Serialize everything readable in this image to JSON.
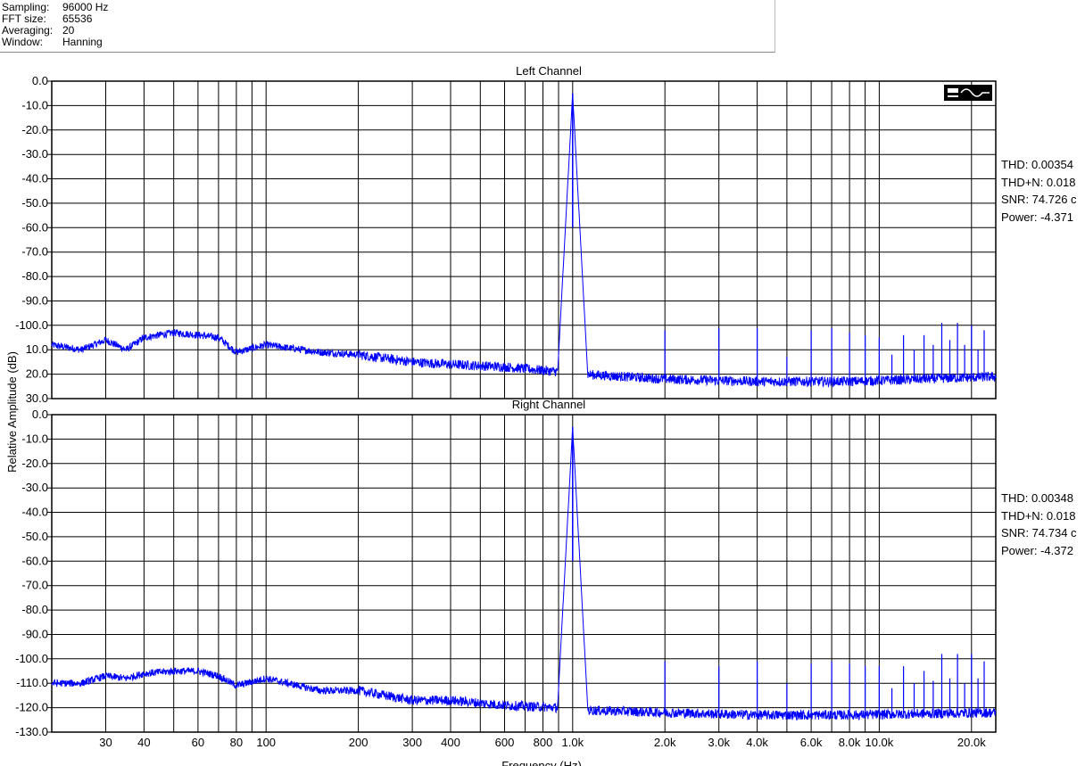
{
  "info": [
    {
      "key": "Sampling:",
      "value": "96000 Hz"
    },
    {
      "key": "FFT size:",
      "value": "65536"
    },
    {
      "key": "Averaging:",
      "value": "20"
    },
    {
      "key": "Window:",
      "value": "Hanning"
    }
  ],
  "stats": {
    "left": {
      "thd": "THD: 0.00354",
      "thdn": "THD+N: 0.018",
      "snr": "SNR: 74.726 c",
      "power": "Power: -4.371"
    },
    "right": {
      "thd": "THD: 0.00348",
      "thdn": "THD+N: 0.018",
      "snr": "SNR: 74.734 c",
      "power": "Power: -4.372"
    }
  },
  "chart_data": {
    "type": "line",
    "xlabel": "Frequency (Hz)",
    "ylabel": "Relative Amplitude (dB)",
    "xscale": "log",
    "xlim": [
      20,
      24000
    ],
    "ylim": [
      -130,
      0
    ],
    "grid": true,
    "line_color": "#0000ff",
    "x_ticks": [
      {
        "v": 30,
        "label": "30"
      },
      {
        "v": 40,
        "label": "40"
      },
      {
        "v": 60,
        "label": "60"
      },
      {
        "v": 80,
        "label": "80"
      },
      {
        "v": 100,
        "label": "100"
      },
      {
        "v": 200,
        "label": "200"
      },
      {
        "v": 300,
        "label": "300"
      },
      {
        "v": 400,
        "label": "400"
      },
      {
        "v": 600,
        "label": "600"
      },
      {
        "v": 800,
        "label": "800"
      },
      {
        "v": 1000,
        "label": "1.0k"
      },
      {
        "v": 2000,
        "label": "2.0k"
      },
      {
        "v": 3000,
        "label": "3.0k"
      },
      {
        "v": 4000,
        "label": "4.0k"
      },
      {
        "v": 6000,
        "label": "6.0k"
      },
      {
        "v": 8000,
        "label": "8.0k"
      },
      {
        "v": 10000,
        "label": "10.0k"
      },
      {
        "v": 20000,
        "label": "20.0k"
      }
    ],
    "grid_x": [
      30,
      40,
      50,
      60,
      70,
      80,
      90,
      100,
      200,
      300,
      400,
      500,
      600,
      700,
      800,
      900,
      1000,
      2000,
      3000,
      4000,
      5000,
      6000,
      7000,
      8000,
      9000,
      10000,
      20000
    ],
    "y_ticks": [
      {
        "v": 0,
        "label": "0.0"
      },
      {
        "v": -10,
        "label": "-10.0"
      },
      {
        "v": -20,
        "label": "-20.0"
      },
      {
        "v": -30,
        "label": "-30.0"
      },
      {
        "v": -40,
        "label": "-40.0"
      },
      {
        "v": -50,
        "label": "-50.0"
      },
      {
        "v": -60,
        "label": "-60.0"
      },
      {
        "v": -70,
        "label": "-70.0"
      },
      {
        "v": -80,
        "label": "-80.0"
      },
      {
        "v": -90,
        "label": "-90.0"
      },
      {
        "v": -100,
        "label": "-100.0"
      },
      {
        "v": -110,
        "label": "-110.0"
      },
      {
        "v": -120,
        "label": "-120.0"
      },
      {
        "v": -130,
        "label": "-130.0"
      }
    ],
    "y_ticks_top_clipped": [
      {
        "v": 0,
        "label": "0.0"
      },
      {
        "v": -10,
        "label": "-10.0"
      },
      {
        "v": -20,
        "label": "-20.0"
      },
      {
        "v": -30,
        "label": "-30.0"
      },
      {
        "v": -40,
        "label": "-40.0"
      },
      {
        "v": -50,
        "label": "-50.0"
      },
      {
        "v": -60,
        "label": "-60.0"
      },
      {
        "v": -70,
        "label": "-70.0"
      },
      {
        "v": -80,
        "label": "-80.0"
      },
      {
        "v": -90,
        "label": "-90.0"
      },
      {
        "v": -100,
        "label": "-100.0"
      },
      {
        "v": -110,
        "label": "10.0"
      },
      {
        "v": -120,
        "label": "20.0"
      },
      {
        "v": -130,
        "label": "30.0"
      }
    ],
    "panels": [
      {
        "title": "Left Channel",
        "fundamental": {
          "f": 1000,
          "db": -5
        },
        "floor": [
          [
            20,
            -108
          ],
          [
            25,
            -110
          ],
          [
            30,
            -106
          ],
          [
            35,
            -110
          ],
          [
            40,
            -105
          ],
          [
            50,
            -103
          ],
          [
            60,
            -104
          ],
          [
            70,
            -105
          ],
          [
            80,
            -111
          ],
          [
            100,
            -108
          ],
          [
            150,
            -111
          ],
          [
            200,
            -112
          ],
          [
            300,
            -115
          ],
          [
            400,
            -116
          ],
          [
            600,
            -117
          ],
          [
            900,
            -119
          ]
        ],
        "floor_after": [
          [
            1080,
            -120
          ],
          [
            2000,
            -122
          ],
          [
            4000,
            -123
          ],
          [
            8000,
            -123
          ],
          [
            24000,
            -121
          ]
        ],
        "harmonics": [
          [
            2000,
            -102
          ],
          [
            3000,
            -101
          ],
          [
            4000,
            -101
          ],
          [
            5000,
            -113
          ],
          [
            6000,
            -102
          ],
          [
            7000,
            -101
          ],
          [
            8000,
            -103
          ],
          [
            9000,
            -104
          ],
          [
            10000,
            -105
          ],
          [
            11000,
            -112
          ],
          [
            12000,
            -104
          ],
          [
            13000,
            -110
          ],
          [
            14000,
            -104
          ],
          [
            15000,
            -108
          ],
          [
            16000,
            -99
          ],
          [
            17000,
            -106
          ],
          [
            18000,
            -99
          ],
          [
            19000,
            -108
          ],
          [
            20000,
            -100
          ],
          [
            21000,
            -110
          ],
          [
            22000,
            -102
          ]
        ]
      },
      {
        "title": "Right Channel",
        "fundamental": {
          "f": 1000,
          "db": -5
        },
        "floor": [
          [
            20,
            -110
          ],
          [
            25,
            -110
          ],
          [
            30,
            -107
          ],
          [
            35,
            -108
          ],
          [
            40,
            -106
          ],
          [
            50,
            -105
          ],
          [
            60,
            -105
          ],
          [
            70,
            -107
          ],
          [
            80,
            -111
          ],
          [
            100,
            -108
          ],
          [
            150,
            -113
          ],
          [
            200,
            -113
          ],
          [
            300,
            -117
          ],
          [
            400,
            -117
          ],
          [
            600,
            -119
          ],
          [
            900,
            -120
          ]
        ],
        "floor_after": [
          [
            1080,
            -121
          ],
          [
            2000,
            -122
          ],
          [
            4000,
            -123
          ],
          [
            8000,
            -123
          ],
          [
            24000,
            -122
          ]
        ],
        "harmonics": [
          [
            2000,
            -101
          ],
          [
            3000,
            -103
          ],
          [
            4000,
            -101
          ],
          [
            5000,
            -110
          ],
          [
            6000,
            -102
          ],
          [
            7000,
            -101
          ],
          [
            8000,
            -102
          ],
          [
            9000,
            -103
          ],
          [
            10000,
            -103
          ],
          [
            11000,
            -112
          ],
          [
            12000,
            -103
          ],
          [
            13000,
            -110
          ],
          [
            14000,
            -105
          ],
          [
            15000,
            -109
          ],
          [
            16000,
            -98
          ],
          [
            17000,
            -108
          ],
          [
            18000,
            -98
          ],
          [
            19000,
            -110
          ],
          [
            20000,
            -98
          ],
          [
            21000,
            -108
          ],
          [
            22000,
            -101
          ]
        ]
      }
    ]
  }
}
